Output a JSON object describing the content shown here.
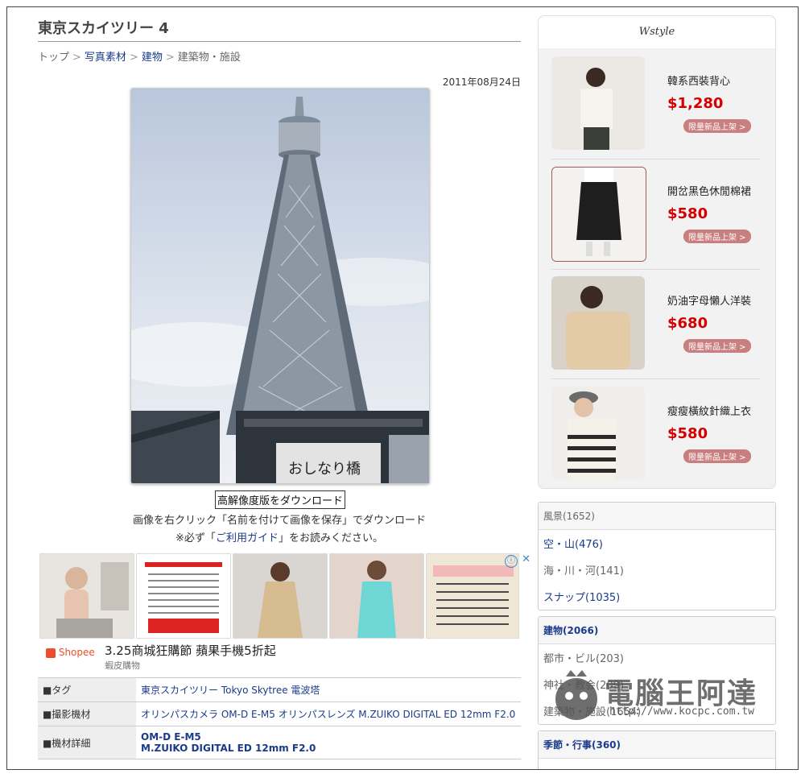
{
  "page": {
    "title": "東京スカイツリー 4",
    "breadcrumb": [
      "トップ",
      "写真素材",
      "建物",
      "建築物・施設"
    ],
    "date": "2011年08月24日",
    "download_button": "高解像度版をダウンロード",
    "download_note": "画像を右クリック「名前を付けて画像を保存」でダウンロード",
    "guide_prefix": "※必ず「",
    "guide_link": "ご利用ガイド",
    "guide_suffix": "」をお読みください。"
  },
  "ad": {
    "brand": "Shopee",
    "headline": "3.25商城狂購節 蘋果手機5折起",
    "sub": "蝦皮購物",
    "info_icon": "ⓘ",
    "close_icon": "✕",
    "colors": {
      "accent": "#ee4d2d"
    }
  },
  "meta": [
    {
      "key": "■タグ",
      "value": "東京スカイツリー Tokyo Skytree 電波塔"
    },
    {
      "key": "■撮影機材",
      "value": "オリンパスカメラ OM-D E-M5 オリンパスレンズ M.ZUIKO DIGITAL ED 12mm F2.0"
    },
    {
      "key": "■機材詳細",
      "value1": "OM-D E-M5",
      "value2": "M.ZUIKO DIGITAL ED 12mm F2.0"
    }
  ],
  "shop": {
    "logo": "Wstyle",
    "products": [
      {
        "name": "韓系西裝背心",
        "price": "$1,280",
        "tag": "限量新品上架 >"
      },
      {
        "name": "開岔黑色休閒棉裙",
        "price": "$580",
        "tag": "限量新品上架 >"
      },
      {
        "name": "奶油字母懶人洋裝",
        "price": "$680",
        "tag": "限量新品上架 >"
      },
      {
        "name": "瘦瘦橫紋針織上衣",
        "price": "$580",
        "tag": "限量新品上架 >"
      }
    ]
  },
  "categories": [
    {
      "title": "風景(1652)",
      "items": [
        "空・山(476)",
        "海・川・河(141)",
        "スナップ(1035)"
      ]
    },
    {
      "title": "建物(2066)",
      "items": [
        "都市・ビル(203)",
        "神社・教会(209)",
        "建築物・施設(1654)"
      ]
    },
    {
      "title": "季節・行事(360)",
      "items": []
    }
  ],
  "watermark": {
    "text": "電腦王阿達",
    "url": "http://www.kocpc.com.tw"
  }
}
